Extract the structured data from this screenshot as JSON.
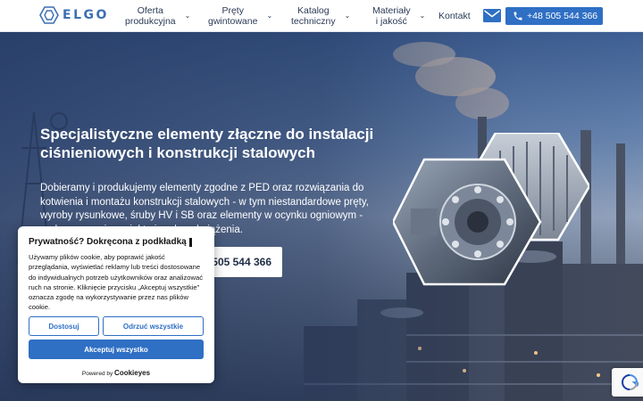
{
  "header": {
    "logo_text": "ELGO",
    "nav": [
      {
        "label": "Oferta\nprodukcyjna",
        "icon": "chevron-down-icon"
      },
      {
        "label": "Pręty\ngwintowane",
        "icon": "chevron-down-icon"
      },
      {
        "label": "Katalog\ntechniczny",
        "icon": "chevron-down-icon"
      },
      {
        "label": "Materiały\ni jakość",
        "icon": "chevron-down-icon"
      }
    ],
    "contact_label": "Kontakt",
    "mail_icon": "mail-icon",
    "phone_icon": "phone-icon",
    "phone_label": "+48 505 544 366",
    "accent_color": "#2f6fc4"
  },
  "hero": {
    "title": "Specjalistyczne elementy złączne do instalacji ciśnieniowych i konstrukcji stalowych",
    "description": "Dobieramy i produkujemy elementy zgodne z PED oraz rozwiązania do kotwienia i montażu konstrukcji stalowych - w tym niestandardowe pręty, wyroby rysunkowe, śruby HV i SB oraz elementy w ocynku ogniowym - pod wymagania projektu i realne obciążenia.",
    "phone_button_label": "505 544 366"
  },
  "cookie": {
    "title": "Prywatność? Dokręcona z podkładką",
    "text": "Używamy plików cookie, aby poprawić jakość przeglądania, wyświetlać reklamy lub treści dostosowane do indywidualnych potrzeb użytkowników oraz analizować ruch na stronie. Kliknięcie przycisku „Akceptuj wszystkie” oznacza zgodę na wykorzystywanie przez nas plików cookie.",
    "deny_label": "Dostosuj",
    "more_label": "Odrzuć wszystkie",
    "accept_label": "Akceptuj wszystko",
    "powered_prefix": "Powered by",
    "powered_brand": "Cookieyes"
  },
  "recaptcha_icon": "recaptcha-icon"
}
